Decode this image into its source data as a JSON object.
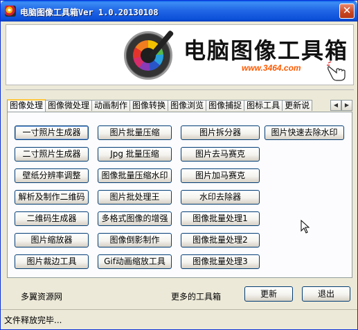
{
  "window": {
    "title": "电脑图像工具箱Ver 1.0.20130108",
    "close_symbol": "✕"
  },
  "banner": {
    "title": "电脑图像工具箱",
    "url": "www.3464.com",
    "logo_icon": "color-wheel-dropper-icon",
    "hand_icon": "pointing-hand-icon"
  },
  "tabs": [
    "图像处理",
    "图像微处理",
    "动画制作",
    "图像转换",
    "图像浏览",
    "图像捕捉",
    "图标工具",
    "更新说"
  ],
  "active_tab": 0,
  "tab_scroll": {
    "left": "◀",
    "right": "▶"
  },
  "buttons": {
    "col1": [
      "一寸照片生成器",
      "二寸照片生成器",
      "壁纸分辨率调整",
      "解析及制作二维码",
      "二维码生成器",
      "图片缩放器",
      "图片裁边工具"
    ],
    "col2": [
      "图片批量压缩",
      "Jpg 批量压缩",
      "图像批量压缩水印",
      "图片批处理王",
      "多格式图像的增强",
      "图像倒影制作",
      "Gif动画缩放工具"
    ],
    "col3": [
      "图片拆分器",
      "图片去马赛克",
      "图片加马赛克",
      "水印去除器",
      "图像批量处理1",
      "图像批量处理2",
      "图像批量处理3"
    ],
    "col4": [
      "图片快速去除水印"
    ]
  },
  "footer": {
    "left_text": "多翼资源网",
    "mid_text": "更多的工具箱",
    "refresh_label": "更新",
    "exit_label": "退出"
  },
  "status": {
    "text": "文件释放完毕..."
  }
}
